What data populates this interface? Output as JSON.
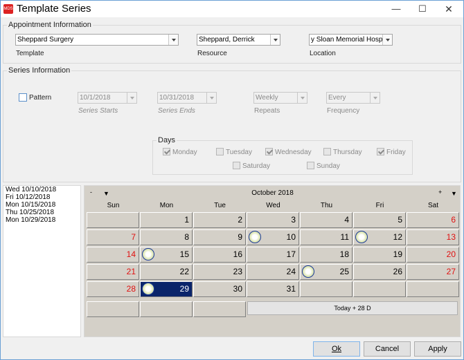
{
  "window": {
    "title": "Template Series",
    "icon": "app-icon"
  },
  "appointment": {
    "group_title": "Appointment Information",
    "template": {
      "value": "Sheppard Surgery",
      "label": "Template"
    },
    "resource": {
      "value": "Sheppard, Derrick",
      "label": "Resource"
    },
    "location": {
      "value": "y Sloan Memorial Hospital",
      "label": "Location"
    }
  },
  "series": {
    "group_title": "Series Information",
    "pattern_label": "Pattern",
    "series_starts": {
      "value": "10/1/2018",
      "label": "Series Starts"
    },
    "series_ends": {
      "value": "10/31/2018",
      "label": "Series Ends"
    },
    "repeats": {
      "value": "Weekly",
      "label": "Repeats"
    },
    "frequency": {
      "value": "Every",
      "label": "Frequency"
    },
    "days_title": "Days",
    "days": {
      "monday": "Monday",
      "tuesday": "Tuesday",
      "wednesday": "Wednesday",
      "thursday": "Thursday",
      "friday": "Friday",
      "saturday": "Saturday",
      "sunday": "Sunday"
    }
  },
  "date_list": [
    "Wed 10/10/2018",
    "Fri 10/12/2018",
    "Mon 10/15/2018",
    "Thu 10/25/2018",
    "Mon 10/29/2018"
  ],
  "calendar": {
    "prev": "-",
    "next": "+",
    "month": "October 2018",
    "weekdays": [
      "Sun",
      "Mon",
      "Tue",
      "Wed",
      "Thu",
      "Fri",
      "Sat"
    ],
    "weeks": [
      [
        "",
        "1",
        "2",
        "3",
        "4",
        "5",
        "6"
      ],
      [
        "7",
        "8",
        "9",
        "10",
        "11",
        "12",
        "13"
      ],
      [
        "14",
        "15",
        "16",
        "17",
        "18",
        "19",
        "20"
      ],
      [
        "21",
        "22",
        "23",
        "24",
        "25",
        "26",
        "27"
      ],
      [
        "28",
        "29",
        "30",
        "31",
        "",
        "",
        ""
      ]
    ],
    "today_button": "Today + 28 D",
    "weekend_color": "#e01010",
    "selected_color": "#0a246a"
  },
  "buttons": {
    "ok": "Ok",
    "cancel": "Cancel",
    "apply": "Apply"
  }
}
